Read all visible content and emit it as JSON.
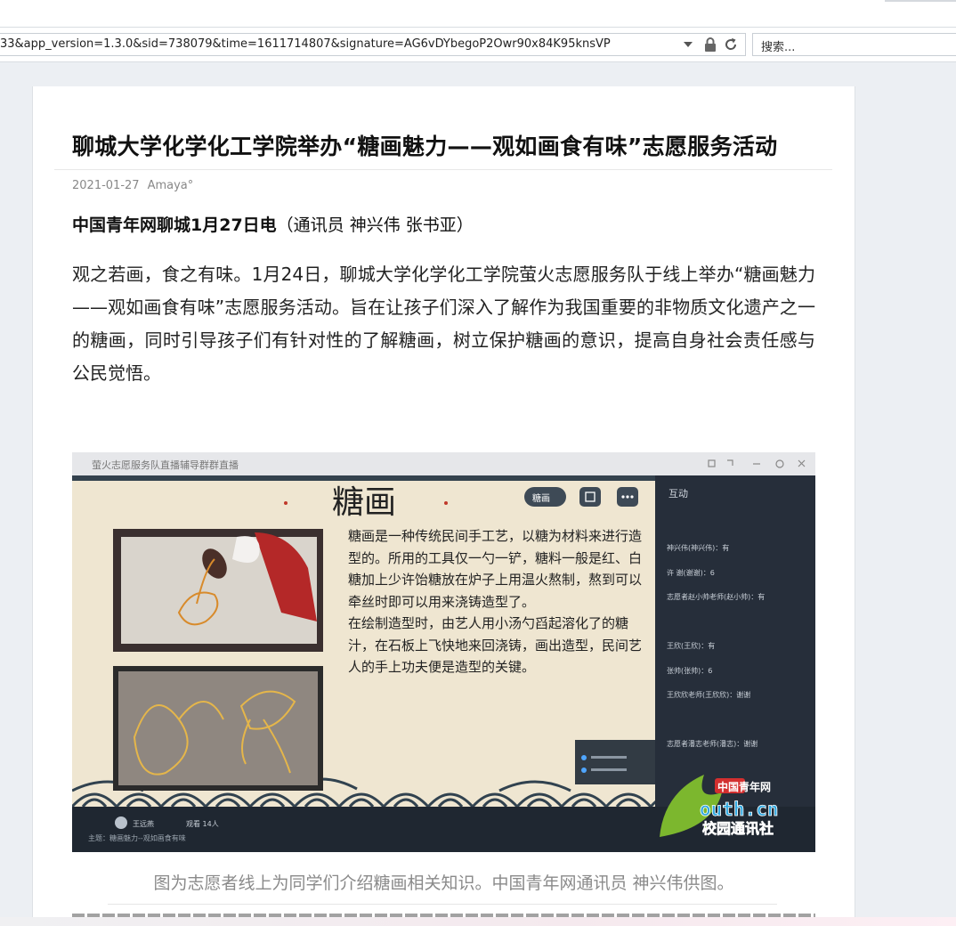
{
  "browser": {
    "url": "33&app_version=1.3.0&sid=738079&time=1611714807&signature=AG6vDYbegoP2Owr90x84K95knsVP",
    "search_placeholder": "搜索..."
  },
  "article": {
    "title": "聊城大学化学化工学院举办“糖画魅力——观如画食有味”志愿服务活动",
    "date": "2021-01-27",
    "author": "Amaya°",
    "lead_bold": "中国青年网聊城1月27日电",
    "lead_rest": "（通讯员 神兴伟 张书亚）",
    "body": "观之若画，食之有味。1月24日，聊城大学化学化工学院萤火志愿服务队于线上举办“糖画魅力——观如画食有味”志愿服务活动。旨在让孩子们深入了解作为我国重要的非物质文化遗产之一的糖画，同时引导孩子们有针对性的了解糖画，树立保护糖画的意识，提高自身社会责任感与公民觉悟。",
    "caption": "图为志愿者线上为同学们介绍糖画相关知识。中国青年网通讯员 神兴伟供图。"
  },
  "figure": {
    "window_title": "萤火志愿服务队直播辅导群群直播",
    "slide_heading": "糖画",
    "slide_text_1": "糖画是一种传统民间手工艺，以糖为材料来进行造型的。所用的工具仅一勺一铲，糖料一般是红、白糖加上少许饴糖放在炉子上用温火熬制，熬到可以牵丝时即可以用来浇铸造型了。",
    "slide_text_2": "在绘制造型时，由艺人用小汤勺舀起溶化了的糖汁，在石板上飞快地来回浇铸，画出造型，民间艺人的手上功夫便是造型的关键。",
    "pill_label": "糖画",
    "panel_title": "互动",
    "panel_items": [
      "神兴伟(神兴伟)：有",
      "许 谢(谢谢)：6",
      "志愿者赵小帅老师(赵小帅)：有",
      "王欣(王欣)：有",
      "张帅(张帅)：6",
      "王欣欣老师(王欣欣)：谢谢",
      "志愿者潘志老师(潘志)：谢谢"
    ],
    "bottom_host": "王远燕",
    "bottom_views": "观看 14人",
    "bottom_topic": "主题：糖画魅力--观如画食有味",
    "watermark_top": "中国青年网",
    "watermark_mid": "outh.cn",
    "watermark_bottom": "校园通讯社",
    "colors": {
      "slide_bg": "#efe6d1",
      "panel_bg": "#262e3a",
      "wave": "#31424f"
    }
  }
}
